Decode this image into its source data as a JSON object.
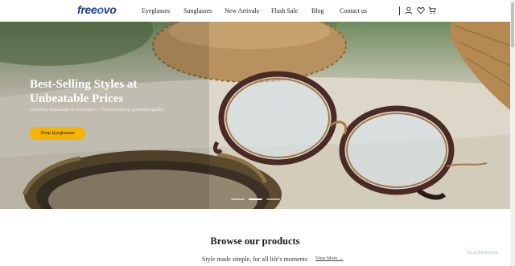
{
  "header": {
    "logo": {
      "part1": "free",
      "part2": "o",
      "part3": "vo"
    },
    "nav": [
      {
        "label": "Eyeglasses"
      },
      {
        "label": "Sunglasses"
      },
      {
        "label": "New Arrivals"
      },
      {
        "label": "Flash Sale"
      },
      {
        "label": "Blog"
      },
      {
        "label": "Contact us"
      }
    ],
    "icons": [
      "user-icon",
      "heart-icon",
      "cart-icon"
    ]
  },
  "hero": {
    "title": "Best-Selling Styles at Unbeatable Prices",
    "subtitle": "Loved by thousands of customers — Forever prices, premium quality",
    "cta_label": "Shop Eyeglasses",
    "slides_total": 3,
    "slide_active": 2,
    "accent_color": "#f4b400"
  },
  "products": {
    "title": "Browse our products",
    "subtitle": "Style made simple, for all life's moments",
    "view_more": "View More →"
  },
  "watermark": "ScanMalware"
}
